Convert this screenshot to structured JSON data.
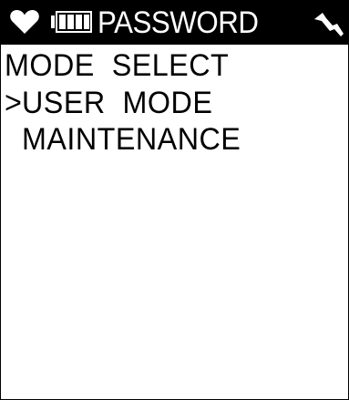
{
  "status_bar": {
    "title": "PASSWORD",
    "icons": [
      "heart-icon",
      "battery-icon",
      "signal-icon"
    ]
  },
  "menu": {
    "heading": "MODE  SELECT",
    "cursor": ">",
    "items": [
      {
        "label": "USER  MODE",
        "selected": true
      },
      {
        "label": "MAINTENANCE",
        "selected": false
      }
    ]
  }
}
